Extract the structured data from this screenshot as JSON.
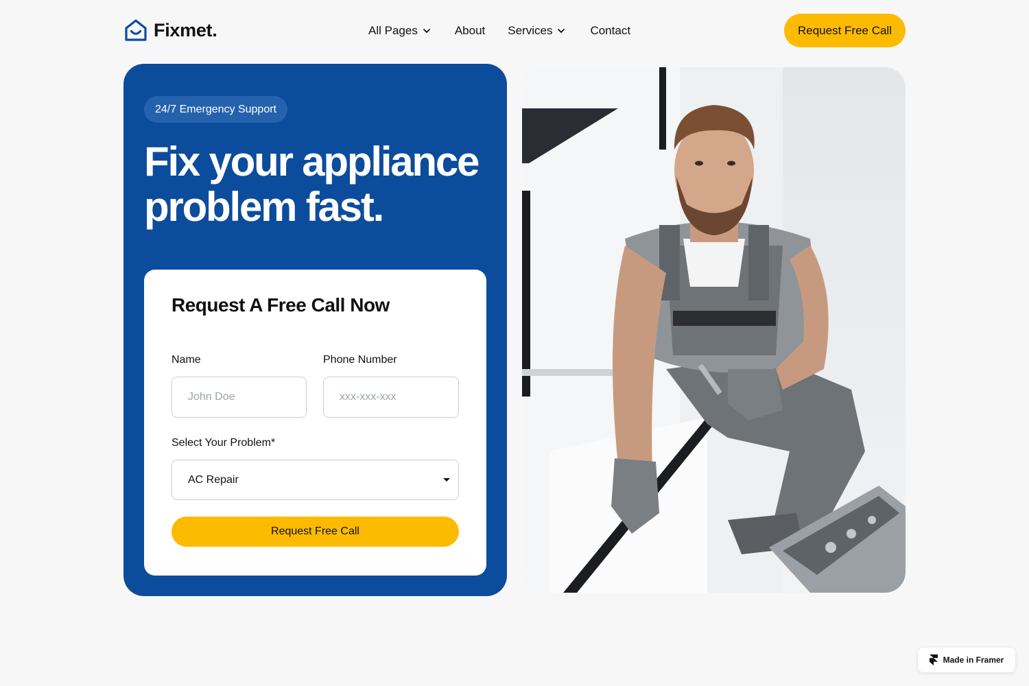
{
  "nav": {
    "logo_text": "Fixmet.",
    "items": [
      {
        "label": "All Pages",
        "has_dropdown": true
      },
      {
        "label": "About",
        "has_dropdown": false
      },
      {
        "label": "Services",
        "has_dropdown": true
      },
      {
        "label": "Contact",
        "has_dropdown": false
      }
    ],
    "cta_label": "Request Free Call"
  },
  "hero": {
    "badge": "24/7 Emergency Support",
    "headline_line1": "Fix your appliance",
    "headline_line2": "problem fast."
  },
  "form": {
    "title": "Request A Free Call Now",
    "name_label": "Name",
    "name_placeholder": "John Doe",
    "phone_label": "Phone Number",
    "phone_placeholder": "xxx-xxx-xxx",
    "problem_label": "Select Your Problem*",
    "problem_selected": "AC Repair",
    "submit_label": "Request Free Call"
  },
  "badge": {
    "label": "Made in Framer"
  },
  "colors": {
    "brand_blue": "#0c4c9c",
    "accent_yellow": "#fdbb00",
    "background": "#f7f7f7"
  },
  "icons": {
    "logo": "house-smile-icon",
    "dropdown": "chevron-down-icon",
    "framer": "framer-logo-icon"
  }
}
